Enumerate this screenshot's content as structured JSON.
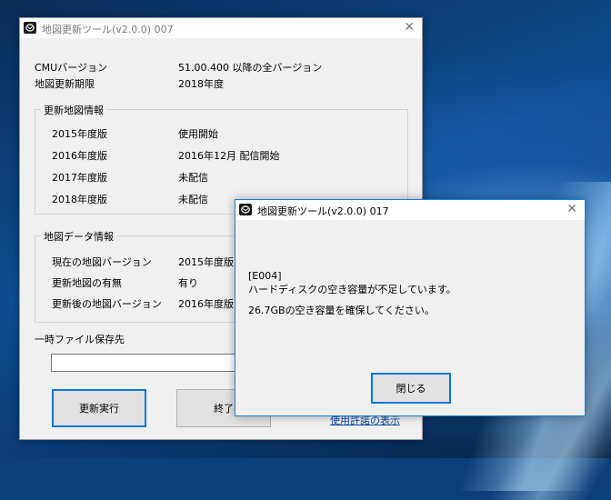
{
  "main_window": {
    "title": "地図更新ツール(v2.0.0) 007",
    "cmu_label": "CMUバージョン",
    "cmu_value": "51.00.400 以降の全バージョン",
    "period_label": "地図更新期限",
    "period_value": "2018年度",
    "update_info": {
      "legend": "更新地図情報",
      "rows": [
        {
          "label": "2015年度版",
          "value": "使用開始"
        },
        {
          "label": "2016年度版",
          "value": "2016年12月 配信開始"
        },
        {
          "label": "2017年度版",
          "value": "未配信"
        },
        {
          "label": "2018年度版",
          "value": "未配信"
        }
      ]
    },
    "map_data_info": {
      "legend": "地図データ情報",
      "rows": [
        {
          "label": "現在の地図バージョン",
          "value": "2015年度版"
        },
        {
          "label": "更新地図の有無",
          "value": "有り"
        },
        {
          "label": "更新後の地図バージョン",
          "value": "2016年度版"
        }
      ]
    },
    "temp_folder_label": "一時ファイル保存先",
    "temp_folder_value": "",
    "execute_button": "更新実行",
    "exit_button": "終了",
    "license_link": "使用許諾の表示"
  },
  "error_dialog": {
    "title": "地図更新ツール(v2.0.0) 017",
    "error_code": "[E004]",
    "message_line1": "ハードディスクの空き容量が不足しています。",
    "message_line2": "26.7GBの空き容量を確保してください。",
    "close_button": "閉じる"
  }
}
